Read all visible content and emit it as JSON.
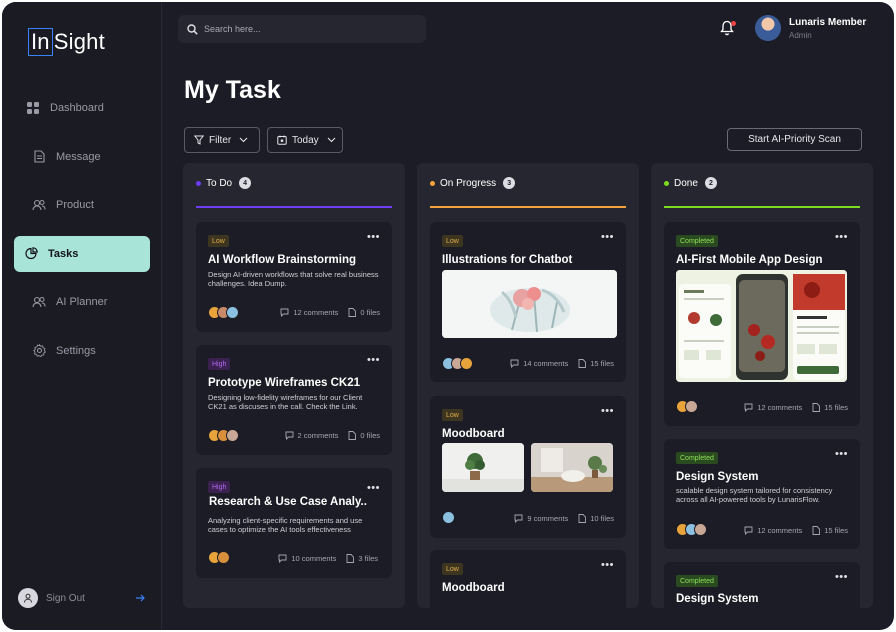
{
  "app": {
    "logo_box": "In",
    "logo_rest": "Sight"
  },
  "sidebar": {
    "items": [
      {
        "label": "Dashboard",
        "icon": "grid-icon"
      },
      {
        "label": "Message",
        "icon": "document-icon"
      },
      {
        "label": "Product",
        "icon": "users-icon"
      },
      {
        "label": "Tasks",
        "icon": "pie-chart-icon",
        "active": true
      },
      {
        "label": "AI Planner",
        "icon": "users-icon"
      },
      {
        "label": "Settings",
        "icon": "gear-icon"
      }
    ],
    "signout": {
      "label": "Sign Out",
      "icon": "arrow-right-icon"
    }
  },
  "search": {
    "placeholder": "Search here..."
  },
  "user": {
    "name": "Lunaris Member",
    "role": "Admin"
  },
  "page": {
    "title": "My Task"
  },
  "controls": {
    "filter": "Filter",
    "date": "Today",
    "ai_button": "Start AI-Priority Scan"
  },
  "colors": {
    "todo": "#6d3df5",
    "progress": "#f5a33d",
    "done": "#7ddc1f",
    "active_nav": "#a9e4d8"
  },
  "columns": [
    {
      "title": "To Do",
      "count": "4",
      "cards": [
        {
          "tag": "Low",
          "title": "AI Workflow Brainstorming",
          "desc": "Design AI-driven workflows that solve real business challenges. Idea Dump.",
          "comments": "12 comments",
          "files": "0 files"
        },
        {
          "tag": "High",
          "title": "Prototype Wireframes CK21",
          "desc": "Designing low-fidelity wireframes for our Client CK21 as discuses in the call. Check the Link.",
          "comments": "2 comments",
          "files": "0 files"
        },
        {
          "tag": "High",
          "title": "Research & Use Case Analy..",
          "desc": "Analyzing client-specific requirements and use cases to optimize the AI tools effectiveness",
          "comments": "10 comments",
          "files": "3 files"
        }
      ]
    },
    {
      "title": "On Progress",
      "count": "3",
      "cards": [
        {
          "tag": "Low",
          "title": "Illustrations for Chatbot",
          "comments": "14 comments",
          "files": "15 files"
        },
        {
          "tag": "Low",
          "title": "Moodboard",
          "comments": "9 comments",
          "files": "10 files"
        },
        {
          "tag": "Low",
          "title": "Moodboard"
        }
      ]
    },
    {
      "title": "Done",
      "count": "2",
      "cards": [
        {
          "tag": "Completed",
          "title": "AI-First Mobile App Design",
          "comments": "12 comments",
          "files": "15 files"
        },
        {
          "tag": "Completed",
          "title": "Design System",
          "desc": "scalable design system tailored for consistency across all AI-powered tools by LunarisFlow.",
          "comments": "12 comments",
          "files": "15 files"
        },
        {
          "tag": "Completed",
          "title": "Design System"
        }
      ]
    }
  ]
}
